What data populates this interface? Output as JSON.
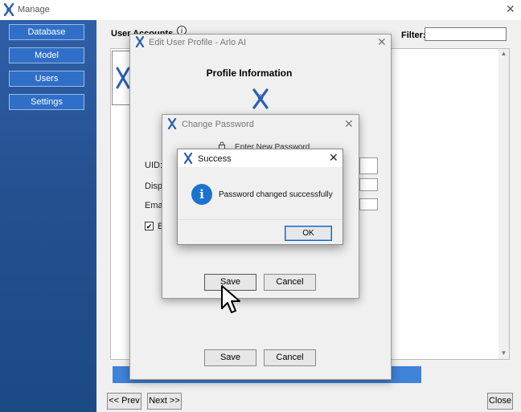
{
  "window": {
    "title": "Manage",
    "close_glyph": "✕"
  },
  "sidebar": {
    "items": [
      {
        "label": "Database"
      },
      {
        "label": "Model"
      },
      {
        "label": "Users"
      },
      {
        "label": "Settings"
      }
    ]
  },
  "main": {
    "users_label": "User Accounts",
    "info_glyph": "i",
    "filter_label": "Filter:",
    "filter_value": "",
    "scroll_up_glyph": "▲",
    "scroll_down_glyph": "▼"
  },
  "footer": {
    "prev_label": "<< Prev",
    "next_label": "Next >>",
    "close_label": "Close"
  },
  "edit_dialog": {
    "title": "Edit User Profile - Arlo AI",
    "close_glyph": "✕",
    "heading": "Profile Information",
    "fields": [
      {
        "label": "UID:"
      },
      {
        "label": "Displ"
      },
      {
        "label": "Emai"
      }
    ],
    "checkbox_mark": "✔",
    "checkbox_label": "E",
    "save_label": "Save",
    "cancel_label": "Cancel"
  },
  "password_dialog": {
    "title": "Change Password",
    "close_glyph": "✕",
    "prompt": "Enter New Password",
    "save_label": "Save",
    "cancel_label": "Cancel"
  },
  "success_dialog": {
    "title": "Success",
    "close_glyph": "✕",
    "icon": "information-icon",
    "icon_glyph": "i",
    "message": "Password changed successfully",
    "ok_label": "OK"
  },
  "colors": {
    "sidebar": "#24508f",
    "nav_button": "#2f6fc7",
    "accent_bar": "#3f82d8",
    "info_icon": "#1a73cf",
    "logo": "#2a5fb0"
  }
}
